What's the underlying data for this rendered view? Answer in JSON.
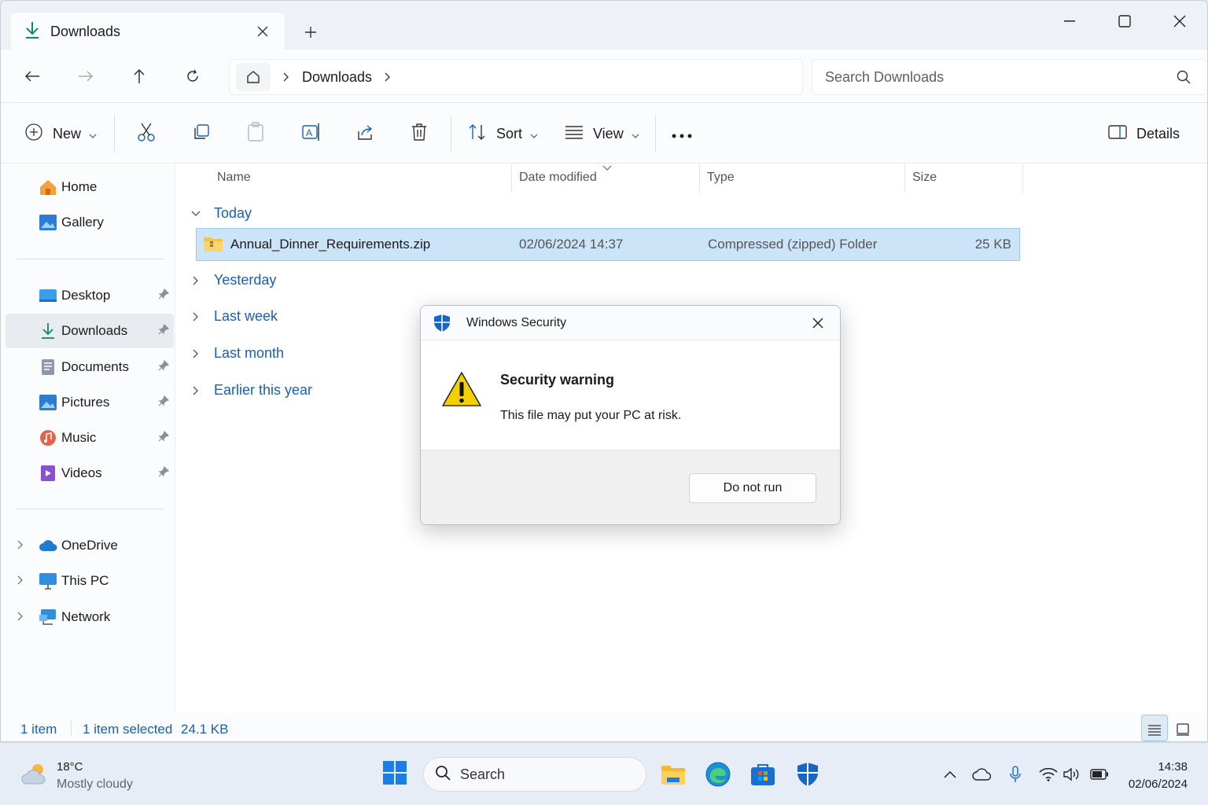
{
  "tab": {
    "title": "Downloads"
  },
  "address": {
    "crumbs": [
      "Downloads"
    ]
  },
  "search": {
    "placeholder": "Search Downloads"
  },
  "commands": {
    "new": "New",
    "sort": "Sort",
    "view": "View",
    "details": "Details"
  },
  "sidebar": {
    "items": [
      {
        "label": "Home",
        "icon": "home-icon"
      },
      {
        "label": "Gallery",
        "icon": "gallery-icon"
      },
      {
        "label": "Desktop",
        "icon": "desktop-icon"
      },
      {
        "label": "Downloads",
        "icon": "download-icon"
      },
      {
        "label": "Documents",
        "icon": "documents-icon"
      },
      {
        "label": "Pictures",
        "icon": "pictures-icon"
      },
      {
        "label": "Music",
        "icon": "music-icon"
      },
      {
        "label": "Videos",
        "icon": "videos-icon"
      },
      {
        "label": "OneDrive",
        "icon": "onedrive-icon"
      },
      {
        "label": "This PC",
        "icon": "this-pc-icon"
      },
      {
        "label": "Network",
        "icon": "network-icon"
      }
    ]
  },
  "columns": {
    "name": "Name",
    "date": "Date modified",
    "type": "Type",
    "size": "Size"
  },
  "groups": [
    "Today",
    "Yesterday",
    "Last week",
    "Last month",
    "Earlier this year"
  ],
  "file": {
    "name": "Annual_Dinner_Requirements.zip",
    "date": "02/06/2024 14:37",
    "type": "Compressed (zipped) Folder",
    "size": "25 KB"
  },
  "status": {
    "count": "1 item",
    "selected": "1 item selected",
    "size": "24.1 KB"
  },
  "dialog": {
    "title": "Windows Security",
    "heading": "Security warning",
    "message": "This file may put your PC at risk.",
    "button": "Do not run"
  },
  "taskbar": {
    "weather_temp": "18°C",
    "weather_cond": "Mostly cloudy",
    "search": "Search",
    "time": "14:38",
    "date": "02/06/2024"
  },
  "colors": {
    "accent": "#1a5fb4",
    "selection": "#cce4f7",
    "warning": "#f5d000"
  }
}
